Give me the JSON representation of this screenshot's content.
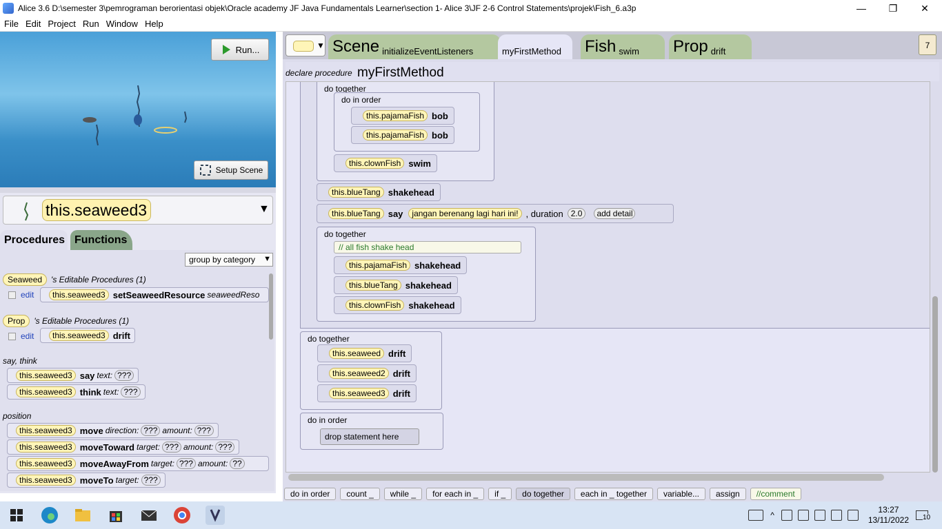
{
  "titlebar": {
    "title": "Alice 3.6 D:\\semester 3\\pemrograman berorientasi objek\\Oracle academy JF Java Fundamentals Learner\\section 1- Alice 3\\JF 2-6 Control Statements\\projek\\Fish_6.a3p",
    "minimize": "—",
    "restore": "❐",
    "close": "✕"
  },
  "menu": [
    "File",
    "Edit",
    "Project",
    "Run",
    "Window",
    "Help"
  ],
  "scene": {
    "run_label": "Run...",
    "setup_label": "Setup Scene"
  },
  "selector": {
    "value": "this.seaweed3",
    "arrow": "▼"
  },
  "left_tabs": {
    "procedures": "Procedures",
    "functions": "Functions"
  },
  "group_by": "group by category",
  "procs": {
    "seaweed_type": "Seaweed",
    "seaweed_editable": "'s Editable Procedures (1)",
    "edit": "edit",
    "set_obj": "this.seaweed3",
    "set_meth": "setSeaweedResource",
    "set_param": "seaweedReso",
    "prop_type": "Prop",
    "prop_editable": "'s Editable Procedures (1)",
    "drift_obj": "this.seaweed3",
    "drift_meth": "drift",
    "cat_say": "say, think",
    "cat_position": "position",
    "say": {
      "obj": "this.seaweed3",
      "meth": "say",
      "param": "text:",
      "val": "???"
    },
    "think": {
      "obj": "this.seaweed3",
      "meth": "think",
      "param": "text:",
      "val": "???"
    },
    "move": {
      "obj": "this.seaweed3",
      "meth": "move",
      "p1": "direction:",
      "v1": "???",
      "p2": "amount:",
      "v2": "???"
    },
    "moveToward": {
      "obj": "this.seaweed3",
      "meth": "moveToward",
      "p1": "target:",
      "v1": "???",
      "p2": "amount:",
      "v2": "???"
    },
    "moveAwayFrom": {
      "obj": "this.seaweed3",
      "meth": "moveAwayFrom",
      "p1": "target:",
      "v1": "???",
      "p2": "amount:",
      "v2": "??"
    },
    "moveTo": {
      "obj": "this.seaweed3",
      "meth": "moveTo",
      "p1": "target:",
      "v1": "???"
    }
  },
  "code_tabs": {
    "scene": "Scene",
    "init": "initializeEventListeners",
    "myfirst": "myFirstMethod",
    "fish": "Fish",
    "swim": "swim",
    "prop": "Prop",
    "drift": "drift",
    "clipboard": "7"
  },
  "declare": {
    "label": "declare procedure",
    "name": "myFirstMethod"
  },
  "code": {
    "do_together": "do together",
    "do_in_order": "do in order",
    "pajama": "this.pajamaFish",
    "bob": "bob",
    "clown": "this.clownFish",
    "swim": "swim",
    "bluetang": "this.blueTang",
    "shakehead": "shakehead",
    "say": "say",
    "say_text": "jangan berenang lagi hari ini!",
    "duration_label": ", duration",
    "duration": "2.0",
    "add_detail": "add detail",
    "comment": "// all fish shake head",
    "seaweed": "this.seaweed",
    "seaweed2": "this.seaweed2",
    "seaweed3": "this.seaweed3",
    "drift": "drift",
    "drop": "drop statement here"
  },
  "bottom": [
    "do in order",
    "count _",
    "while _",
    "for each in _",
    "if _",
    "do together",
    "each in _ together",
    "variable...",
    "assign",
    "//comment"
  ],
  "taskbar": {
    "time": "13:27",
    "date": "13/11/2022",
    "notif": "10"
  },
  "colors": {
    "object_tile": "#fff5b8",
    "editor_bg": "#e6e6f6",
    "scene_water": "#4aa0d8"
  }
}
